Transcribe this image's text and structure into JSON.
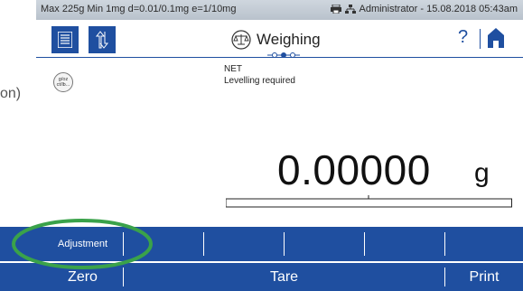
{
  "status_bar": {
    "scale_info": "Max 225g Min 1mg d=0.01/0.1mg e=1/10mg",
    "user_datetime": "Administrator - 15.08.2018 05:43am"
  },
  "header": {
    "title": "Weighing",
    "help_label": "?"
  },
  "left_partial_text": "on)",
  "unit_button": {
    "label_line1": "g/oz",
    "label_line2": "ct/lb..."
  },
  "display": {
    "mode_label": "NET",
    "status_message": "Levelling required",
    "weight_value": "0.00000",
    "weight_unit": "g"
  },
  "softkeys": [
    "Adjustment",
    "",
    "",
    "",
    "",
    ""
  ],
  "function_keys": {
    "zero": "Zero",
    "tare": "Tare",
    "print": "Print"
  },
  "colors": {
    "accent": "#1f4fa0",
    "highlight": "#3aa24a",
    "status_bar": "#c4ccd5"
  },
  "icons": [
    "menu-list-icon",
    "up-down-icon",
    "balance-icon",
    "help-icon",
    "home-icon",
    "printer-icon",
    "network-icon"
  ]
}
